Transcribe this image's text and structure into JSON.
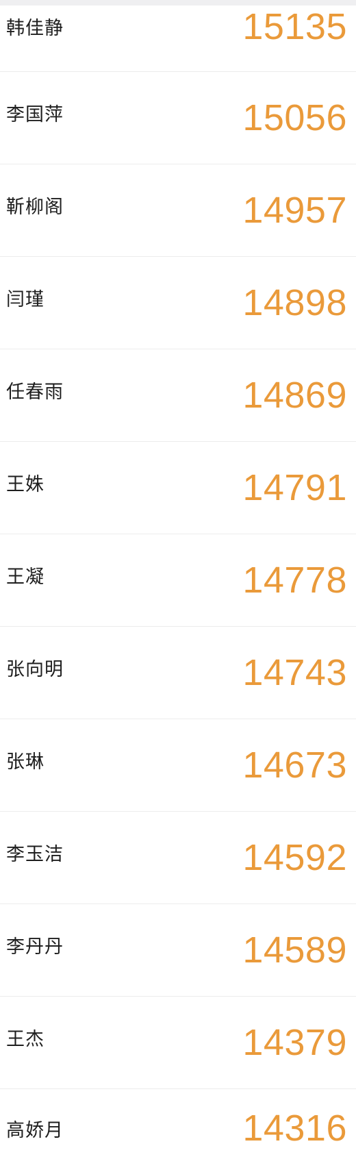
{
  "leaderboard": {
    "rows": [
      {
        "name": "韩佳静",
        "score": "15135"
      },
      {
        "name": "李国萍",
        "score": "15056"
      },
      {
        "name": "靳柳阁",
        "score": "14957"
      },
      {
        "name": "闫瑾",
        "score": "14898"
      },
      {
        "name": "任春雨",
        "score": "14869"
      },
      {
        "name": "王姝",
        "score": "14791"
      },
      {
        "name": "王凝",
        "score": "14778"
      },
      {
        "name": "张向明",
        "score": "14743"
      },
      {
        "name": "张琳",
        "score": "14673"
      },
      {
        "name": "李玉洁",
        "score": "14592"
      },
      {
        "name": "李丹丹",
        "score": "14589"
      },
      {
        "name": "王杰",
        "score": "14379"
      },
      {
        "name": "高娇月",
        "score": "14316"
      }
    ]
  },
  "colors": {
    "score": "#ea9a3a",
    "name": "#1e1e1e",
    "divider": "#ececec",
    "top_strip": "#efeff1"
  }
}
